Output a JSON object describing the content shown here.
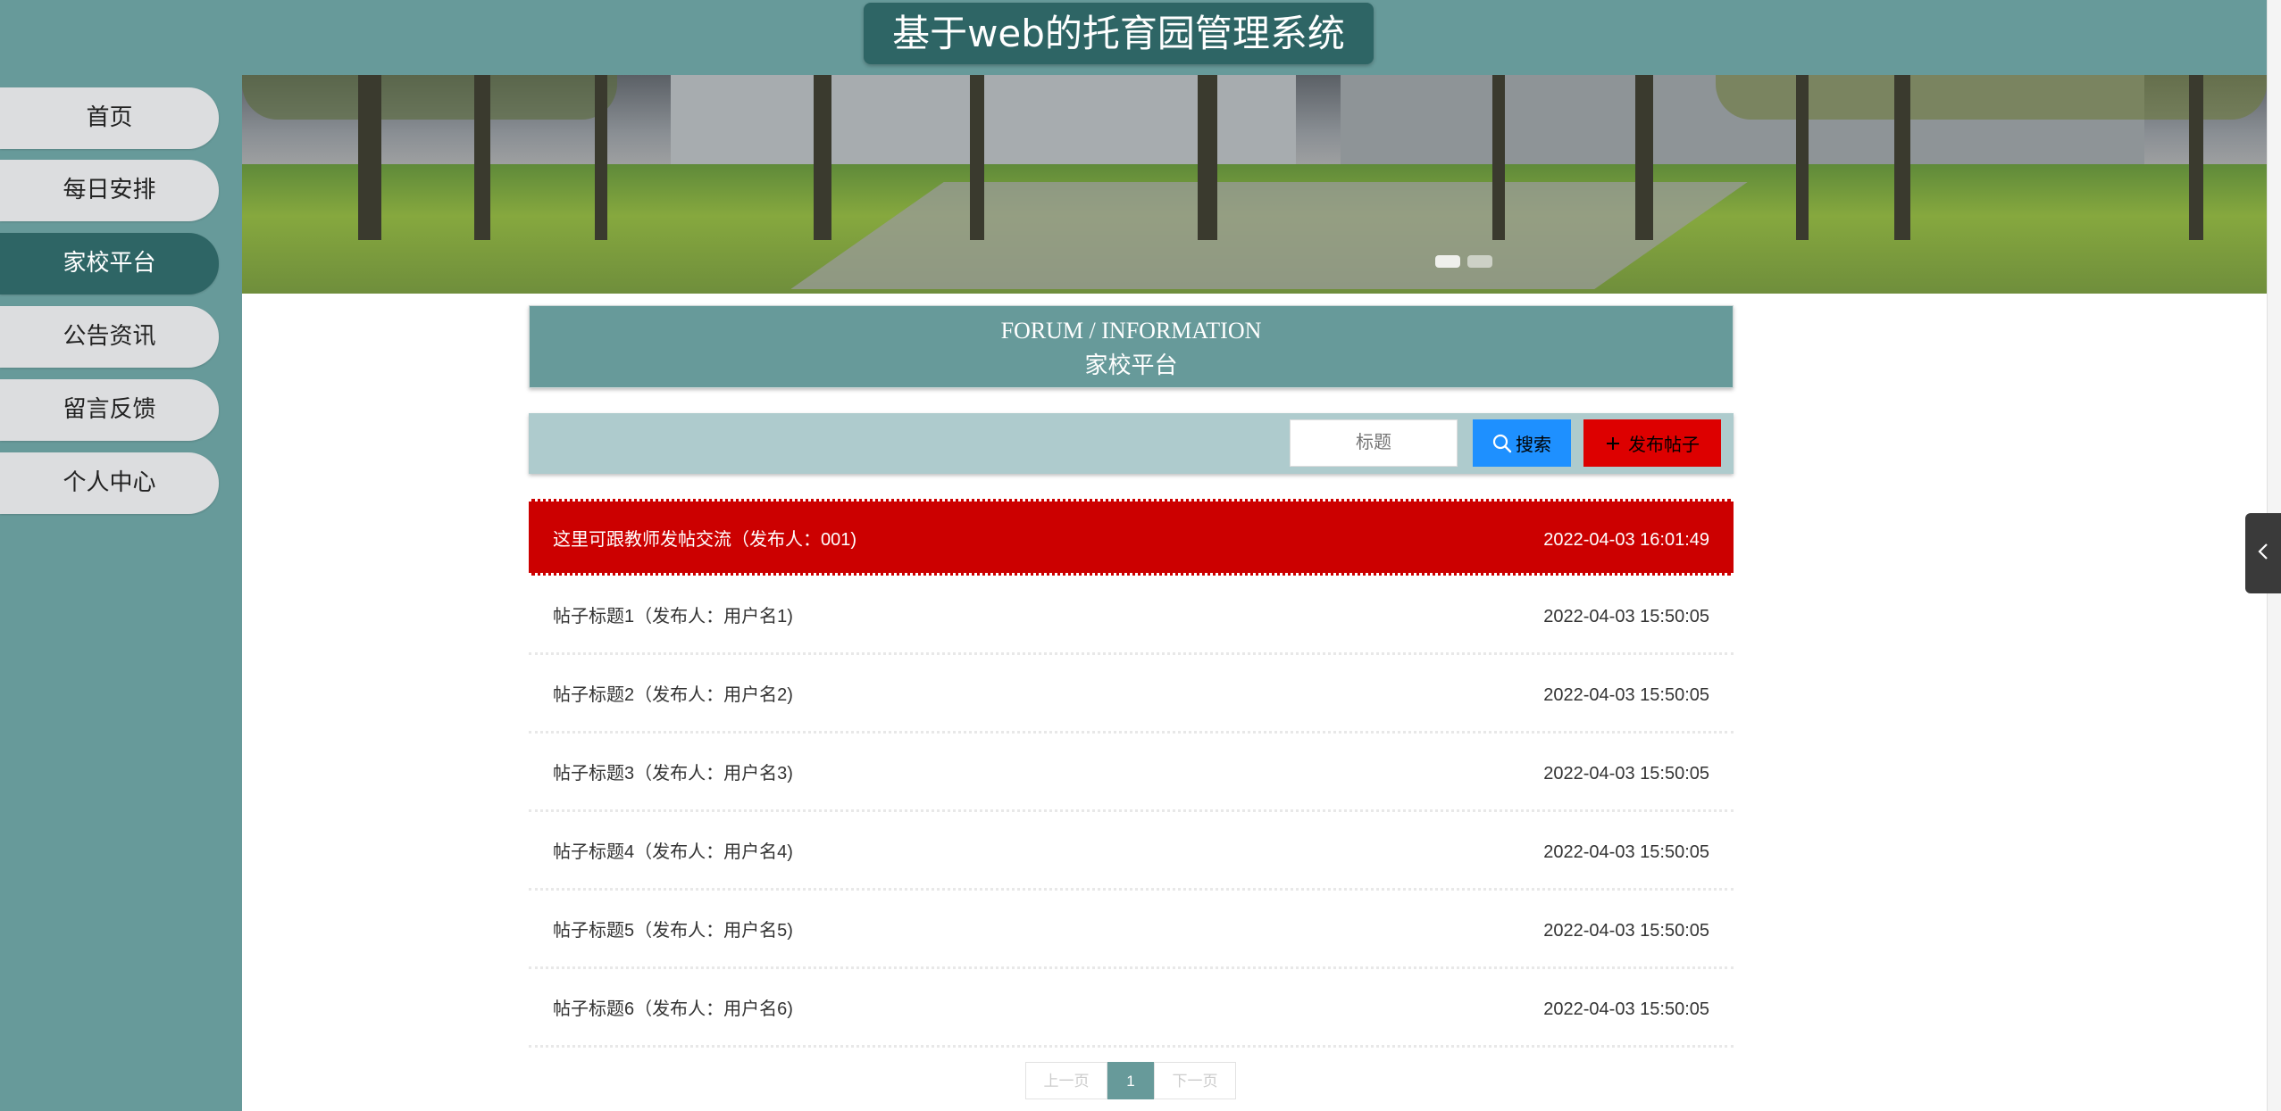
{
  "header": {
    "title": "基于web的托育园管理系统"
  },
  "sidebar": {
    "items": [
      {
        "label": "首页",
        "active": false
      },
      {
        "label": "每日安排",
        "active": false
      },
      {
        "label": "家校平台",
        "active": true
      },
      {
        "label": "公告资讯",
        "active": false
      },
      {
        "label": "留言反馈",
        "active": false
      },
      {
        "label": "个人中心",
        "active": false
      }
    ]
  },
  "section": {
    "title_en": "FORUM / INFORMATION",
    "title_cn": "家校平台"
  },
  "search": {
    "placeholder": "标题",
    "search_label": "搜索",
    "post_label": "发布帖子"
  },
  "posts": [
    {
      "title": "这里可跟教师发帖交流（发布人：001)",
      "time": "2022-04-03 16:01:49",
      "highlighted": true
    },
    {
      "title": "帖子标题1（发布人：用户名1)",
      "time": "2022-04-03 15:50:05"
    },
    {
      "title": "帖子标题2（发布人：用户名2)",
      "time": "2022-04-03 15:50:05"
    },
    {
      "title": "帖子标题3（发布人：用户名3)",
      "time": "2022-04-03 15:50:05"
    },
    {
      "title": "帖子标题4（发布人：用户名4)",
      "time": "2022-04-03 15:50:05"
    },
    {
      "title": "帖子标题5（发布人：用户名5)",
      "time": "2022-04-03 15:50:05"
    },
    {
      "title": "帖子标题6（发布人：用户名6)",
      "time": "2022-04-03 15:50:05"
    }
  ],
  "pagination": {
    "prev": "上一页",
    "current": "1",
    "next": "下一页"
  },
  "colors": {
    "theme": "#679a9a",
    "theme_dark": "#2e6565",
    "highlight_row": "#cc0000",
    "search_button": "#1e90ff",
    "post_button": "#dd0000"
  },
  "icons": {
    "search": "search-icon",
    "post": "plus-icon",
    "side_tab": "chevron-left-icon"
  }
}
